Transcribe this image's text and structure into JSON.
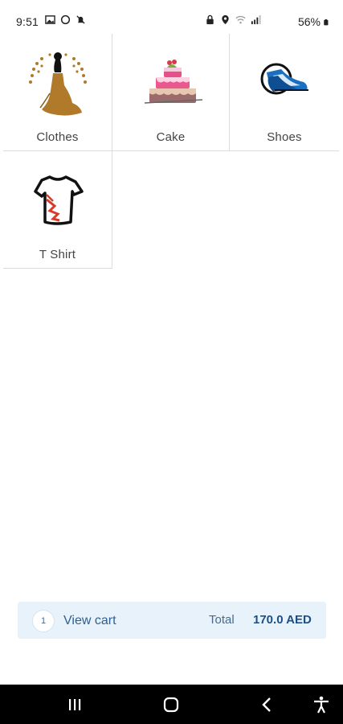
{
  "status_bar": {
    "time": "9:51",
    "battery": "56%",
    "icons": [
      "gallery-icon",
      "circle-icon",
      "mute-icon",
      "lock-icon",
      "location-icon",
      "wifi-icon",
      "signal-icon",
      "battery-icon"
    ]
  },
  "categories": [
    {
      "label": "Clothes",
      "icon": "dress-icon"
    },
    {
      "label": "Cake",
      "icon": "cake-icon"
    },
    {
      "label": "Shoes",
      "icon": "shoes-icon"
    },
    {
      "label": "T Shirt",
      "icon": "tshirt-icon"
    }
  ],
  "cart": {
    "count": "1",
    "label": "View cart",
    "total_label": "Total",
    "total_value": "170.0 AED"
  },
  "nav": {
    "icons": [
      "recent-apps-icon",
      "home-icon",
      "back-icon",
      "accessibility-icon"
    ]
  },
  "colors": {
    "cart_bg": "#e7f2fb",
    "cart_text": "#2f5f8f",
    "total_value": "#1d4f86",
    "nav_bg": "#000000"
  }
}
